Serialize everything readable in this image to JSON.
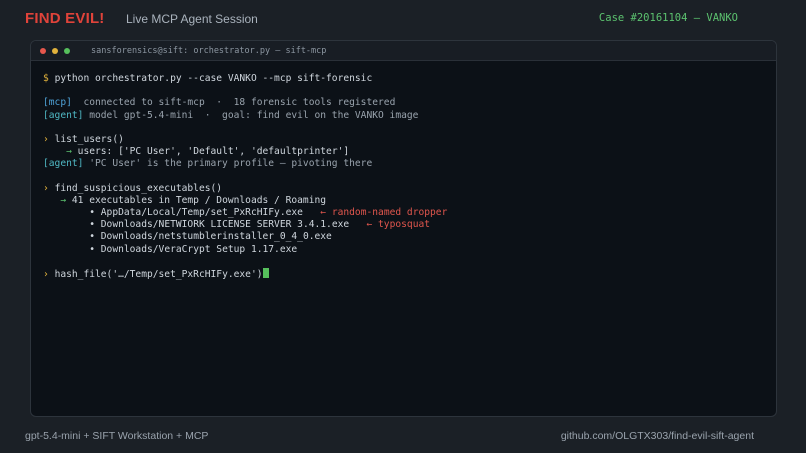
{
  "header": {
    "brand": "FIND EVIL!",
    "session_title": "Live MCP Agent Session",
    "case_id": "Case #20161104 — VANKO"
  },
  "terminal": {
    "title": "sansforensics@sift: orchestrator.py — sift-mcp",
    "command": {
      "prompt": "$",
      "text": "python orchestrator.py --case VANKO --mcp sift-forensic"
    },
    "status": [
      {
        "tag": "[mcp]",
        "text": "  connected to sift-mcp  ·  18 forensic tools registered"
      },
      {
        "tag": "[agent]",
        "text": " model gpt-5.4-mini  ·  goal: find evil on the VANKO image"
      }
    ],
    "list_users": {
      "chevron": "›",
      "call": "list_users()",
      "result_arrow": "→",
      "result": "users: ['PC User', 'Default', 'defaultprinter']",
      "agent_tag": "[agent]",
      "agent_note": " 'PC User' is the primary profile — pivoting there"
    },
    "suspicious": {
      "chevron": "›",
      "call": "find_suspicious_executables()",
      "result_arrow": "→",
      "result": "41 executables in Temp / Downloads / Roaming",
      "items": [
        {
          "bullet": "•",
          "path": "AppData/Local/Temp/set_PxRcHIFy.exe",
          "note": "← random-named dropper"
        },
        {
          "bullet": "•",
          "path": "Downloads/NETWIORK LICENSE SERVER 3.4.1.exe",
          "note": "← typosquat"
        },
        {
          "bullet": "•",
          "path": "Downloads/netstumblerinstaller_0_4_0.exe",
          "note": ""
        },
        {
          "bullet": "•",
          "path": "Downloads/VeraCrypt Setup 1.17.exe",
          "note": ""
        }
      ]
    },
    "hash": {
      "chevron": "›",
      "call": "hash_file('…/Temp/set_PxRcHIFy.exe')"
    }
  },
  "footer": {
    "left": "gpt-5.4-mini  +  SIFT Workstation  +  MCP",
    "right": "github.com/OLGTX303/find-evil-sift-agent"
  }
}
